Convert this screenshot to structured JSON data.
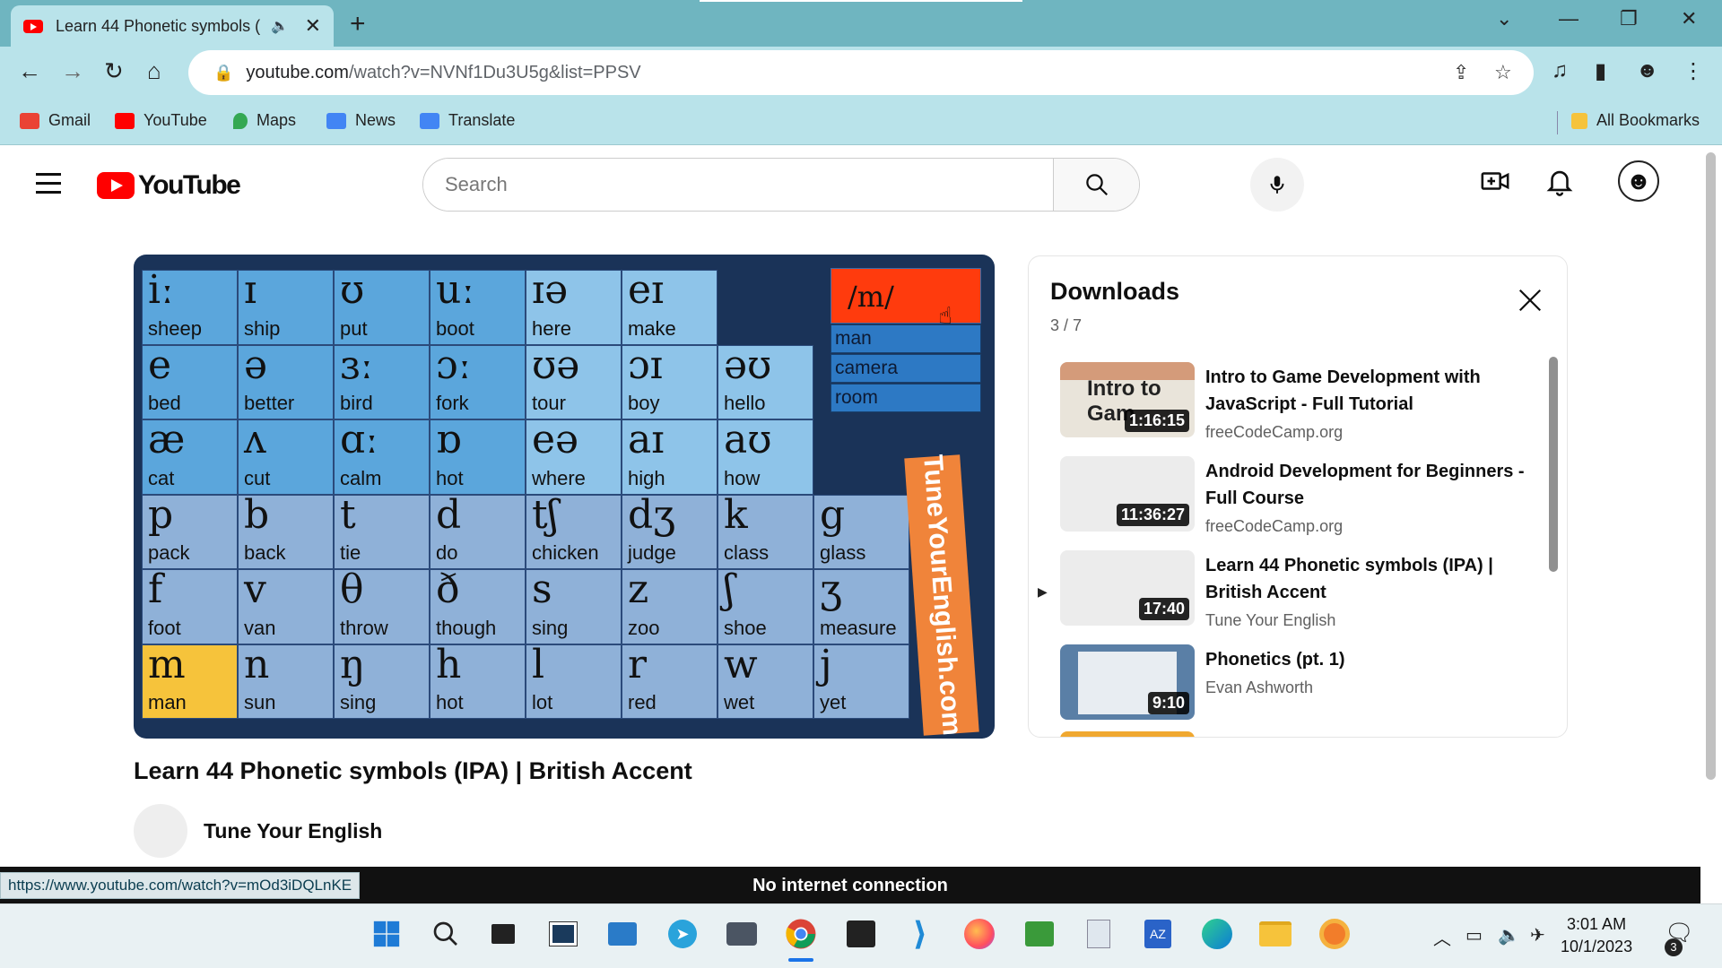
{
  "browser": {
    "tab_title": "Learn 44 Phonetic symbols (",
    "url_domain": "youtube.com",
    "url_rest": "/watch?v=NVNf1Du3U5g&list=PPSV",
    "bookmarks": [
      {
        "label": "Gmail",
        "icon": "gmail-icon",
        "color": "#ea4335"
      },
      {
        "label": "YouTube",
        "icon": "youtube-icon",
        "color": "#ff0000"
      },
      {
        "label": "Maps",
        "icon": "maps-icon",
        "color": "#34a853"
      },
      {
        "label": "News",
        "icon": "news-icon",
        "color": "#4285f4"
      },
      {
        "label": "Translate",
        "icon": "translate-icon",
        "color": "#4285f4"
      }
    ],
    "all_bookmarks": "All Bookmarks"
  },
  "youtube": {
    "logo_text": "YouTube",
    "search_placeholder": "Search"
  },
  "video": {
    "title": "Learn 44 Phonetic symbols (IPA) | British Accent",
    "channel": "Tune Your English",
    "brand_text": "TuneYourEnglish.com",
    "highlight_symbol": "/m/",
    "highlight_words": [
      "man",
      "camera",
      "room"
    ],
    "chart_rows": [
      [
        {
          "s": "iː",
          "w": "sheep",
          "t": "vowel"
        },
        {
          "s": "ɪ",
          "w": "ship",
          "t": "vowel"
        },
        {
          "s": "ʊ",
          "w": "put",
          "t": "vowel"
        },
        {
          "s": "uː",
          "w": "boot",
          "t": "vowel"
        },
        {
          "s": "ɪə",
          "w": "here",
          "t": "diph"
        },
        {
          "s": "eɪ",
          "w": "make",
          "t": "diph"
        }
      ],
      [
        {
          "s": "e",
          "w": "bed",
          "t": "vowel"
        },
        {
          "s": "ə",
          "w": "better",
          "t": "vowel"
        },
        {
          "s": "ɜː",
          "w": "bird",
          "t": "vowel"
        },
        {
          "s": "ɔː",
          "w": "fork",
          "t": "vowel"
        },
        {
          "s": "ʊə",
          "w": "tour",
          "t": "diph"
        },
        {
          "s": "ɔɪ",
          "w": "boy",
          "t": "diph"
        },
        {
          "s": "əʊ",
          "w": "hello",
          "t": "diph"
        }
      ],
      [
        {
          "s": "æ",
          "w": "cat",
          "t": "vowel"
        },
        {
          "s": "ʌ",
          "w": "cut",
          "t": "vowel"
        },
        {
          "s": "ɑː",
          "w": "calm",
          "t": "vowel"
        },
        {
          "s": "ɒ",
          "w": "hot",
          "t": "vowel"
        },
        {
          "s": "eə",
          "w": "where",
          "t": "diph"
        },
        {
          "s": "aɪ",
          "w": "high",
          "t": "diph"
        },
        {
          "s": "aʊ",
          "w": "how",
          "t": "diph"
        }
      ],
      [
        {
          "s": "p",
          "w": "pack",
          "t": "cons"
        },
        {
          "s": "b",
          "w": "back",
          "t": "cons"
        },
        {
          "s": "t",
          "w": "tie",
          "t": "cons"
        },
        {
          "s": "d",
          "w": "do",
          "t": "cons"
        },
        {
          "s": "tʃ",
          "w": "chicken",
          "t": "cons"
        },
        {
          "s": "dʒ",
          "w": "judge",
          "t": "cons"
        },
        {
          "s": "k",
          "w": "class",
          "t": "cons"
        },
        {
          "s": "g",
          "w": "glass",
          "t": "cons"
        }
      ],
      [
        {
          "s": "f",
          "w": "foot",
          "t": "cons"
        },
        {
          "s": "v",
          "w": "van",
          "t": "cons"
        },
        {
          "s": "θ",
          "w": "throw",
          "t": "cons"
        },
        {
          "s": "ð",
          "w": "though",
          "t": "cons"
        },
        {
          "s": "s",
          "w": "sing",
          "t": "cons"
        },
        {
          "s": "z",
          "w": "zoo",
          "t": "cons"
        },
        {
          "s": "ʃ",
          "w": "shoe",
          "t": "cons"
        },
        {
          "s": "ʒ",
          "w": "measure",
          "t": "cons"
        }
      ],
      [
        {
          "s": "m",
          "w": "man",
          "t": "hl"
        },
        {
          "s": "n",
          "w": "sun",
          "t": "cons"
        },
        {
          "s": "ŋ",
          "w": "sing",
          "t": "cons"
        },
        {
          "s": "h",
          "w": "hot",
          "t": "cons"
        },
        {
          "s": "l",
          "w": "lot",
          "t": "cons"
        },
        {
          "s": "r",
          "w": "red",
          "t": "cons"
        },
        {
          "s": "w",
          "w": "wet",
          "t": "cons"
        },
        {
          "s": "j",
          "w": "yet",
          "t": "cons"
        }
      ]
    ]
  },
  "playlist": {
    "title": "Downloads",
    "count": "3 / 7",
    "items": [
      {
        "title": "Intro to Game Development with JavaScript - Full Tutorial",
        "channel": "freeCodeCamp.org",
        "duration": "1:16:15",
        "thumb_text": "Intro to Gam",
        "thumb_color": "#e9e4da"
      },
      {
        "title": "Android Development for Beginners - Full Course",
        "channel": "freeCodeCamp.org",
        "duration": "11:36:27",
        "thumb_text": "",
        "thumb_color": "#ececec"
      },
      {
        "title": "Learn 44 Phonetic symbols (IPA) | British Accent",
        "channel": "Tune Your English",
        "duration": "17:40",
        "thumb_text": "",
        "thumb_color": "#ececec",
        "current": true
      },
      {
        "title": "Phonetics (pt. 1)",
        "channel": "Evan Ashworth",
        "duration": "9:10",
        "thumb_text": "",
        "thumb_color": "#5a7fa6"
      }
    ]
  },
  "status": {
    "hover_url": "https://www.youtube.com/watch?v=mOd3iDQLnKE",
    "offline_text": "No internet connection"
  },
  "taskbar": {
    "time": "3:01 AM",
    "date": "10/1/2023",
    "notifications": "3"
  }
}
